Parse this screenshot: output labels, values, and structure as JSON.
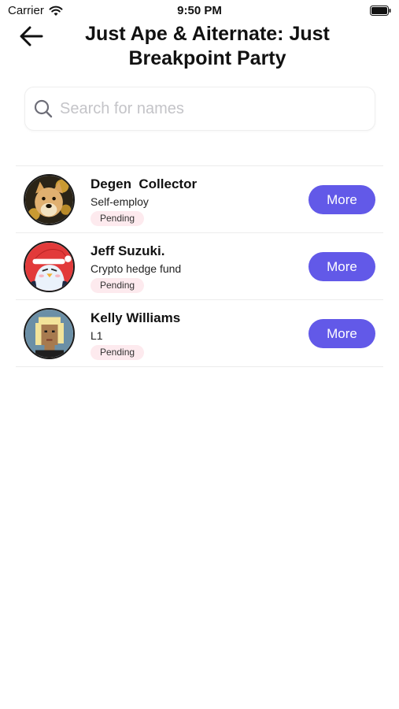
{
  "status_bar": {
    "carrier": "Carrier",
    "time": "9:50 PM",
    "icons": [
      "wifi-icon",
      "battery-icon"
    ]
  },
  "header": {
    "back_icon": "arrow-left-icon",
    "title": "Just Ape & Aiternate: Just Breakpoint Party"
  },
  "search": {
    "icon": "search-icon",
    "placeholder": "Search for names",
    "value": ""
  },
  "colors": {
    "accent": "#6259e8",
    "badge_bg": "#fdeaee",
    "divider": "#ececec"
  },
  "members": [
    {
      "name": "Degen  Collector",
      "subtitle": "Self-employ",
      "status": "Pending",
      "action": "More",
      "avatar": "doge-avatar"
    },
    {
      "name": "Jeff Suzuki.",
      "subtitle": "Crypto hedge fund",
      "status": "Pending",
      "action": "More",
      "avatar": "penguin-avatar"
    },
    {
      "name": "Kelly Williams",
      "subtitle": "L1",
      "status": "Pending",
      "action": "More",
      "avatar": "pixel-punk-avatar"
    }
  ]
}
